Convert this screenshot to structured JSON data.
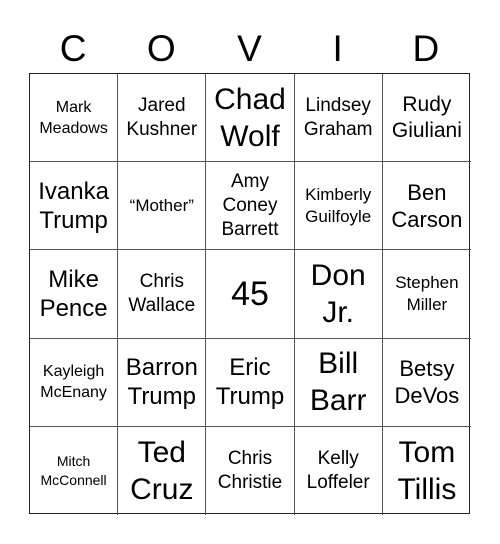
{
  "title_letters": [
    "C",
    "O",
    "V",
    "I",
    "D"
  ],
  "board": [
    [
      "Mark\nMeadows",
      "Jared\nKushner",
      "Chad\nWolf",
      "Lindsey\nGraham",
      "Rudy\nGiuliani"
    ],
    [
      "Ivanka\nTrump",
      "“Mother”",
      "Amy\nConey\nBarrett",
      "Kimberly\nGuilfoyle",
      "Ben\nCarson"
    ],
    [
      "Mike\nPence",
      "Chris\nWallace",
      "45",
      "Don\nJr.",
      "Stephen\nMiller"
    ],
    [
      "Kayleigh\nMcEnany",
      "Barron\nTrump",
      "Eric\nTrump",
      "Bill\nBarr",
      "Betsy\nDeVos"
    ],
    [
      "Mitch\nMcConnell",
      "Ted\nCruz",
      "Chris\nChristie",
      "Kelly\nLoffeler",
      "Tom\nTillis"
    ]
  ]
}
